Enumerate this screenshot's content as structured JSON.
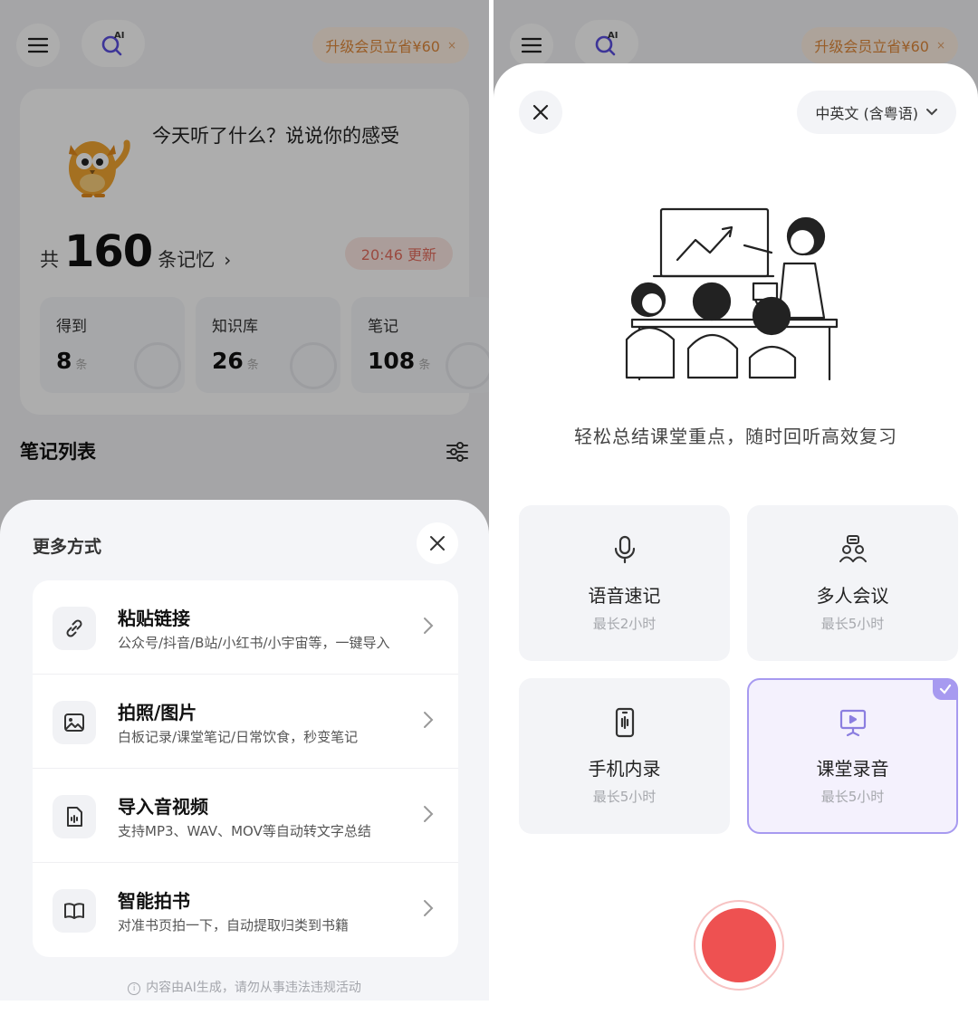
{
  "left": {
    "topbar": {
      "promo_label": "升级会员立省¥60",
      "promo_close": "×"
    },
    "summary": {
      "prompt": "今天听了什么？说说你的感受",
      "memory_prefix": "共",
      "memory_count": "160",
      "memory_suffix": "条记忆",
      "memory_chevron": "›",
      "updated_label": "20:46 更新",
      "stats": [
        {
          "label": "得到",
          "value": "8",
          "unit": "条"
        },
        {
          "label": "知识库",
          "value": "26",
          "unit": "条"
        },
        {
          "label": "笔记",
          "value": "108",
          "unit": "条"
        }
      ]
    },
    "list_title": "笔记列表",
    "sheet": {
      "title": "更多方式",
      "options": [
        {
          "icon": "link-icon",
          "title": "粘贴链接",
          "desc": "公众号/抖音/B站/小红书/小宇宙等，一键导入"
        },
        {
          "icon": "image-icon",
          "title": "拍照/图片",
          "desc": "白板记录/课堂笔记/日常饮食，秒变笔记"
        },
        {
          "icon": "audio-file-icon",
          "title": "导入音视频",
          "desc": "支持MP3、WAV、MOV等自动转文字总结"
        },
        {
          "icon": "book-icon",
          "title": "智能拍书",
          "desc": "对准书页拍一下，自动提取归类到书籍"
        }
      ],
      "footnote": "内容由AI生成，请勿从事违法违规活动"
    }
  },
  "right": {
    "topbar": {
      "promo_label": "升级会员立省¥60",
      "promo_close": "×"
    },
    "language_label": "中英文 (含粤语)",
    "tagline": "轻松总结课堂重点，随时回听高效复习",
    "modes": [
      {
        "icon": "microphone-icon",
        "title": "语音速记",
        "subtitle": "最长2小时",
        "selected": false
      },
      {
        "icon": "people-icon",
        "title": "多人会议",
        "subtitle": "最长5小时",
        "selected": false
      },
      {
        "icon": "phone-record-icon",
        "title": "手机内录",
        "subtitle": "最长5小时",
        "selected": false
      },
      {
        "icon": "presentation-icon",
        "title": "课堂录音",
        "subtitle": "最长5小时",
        "selected": true
      }
    ],
    "record_color": "#ee5151"
  },
  "colors": {
    "accent": "#a79af0",
    "promo": "#e08a3c",
    "updated": "#e46d5f"
  }
}
